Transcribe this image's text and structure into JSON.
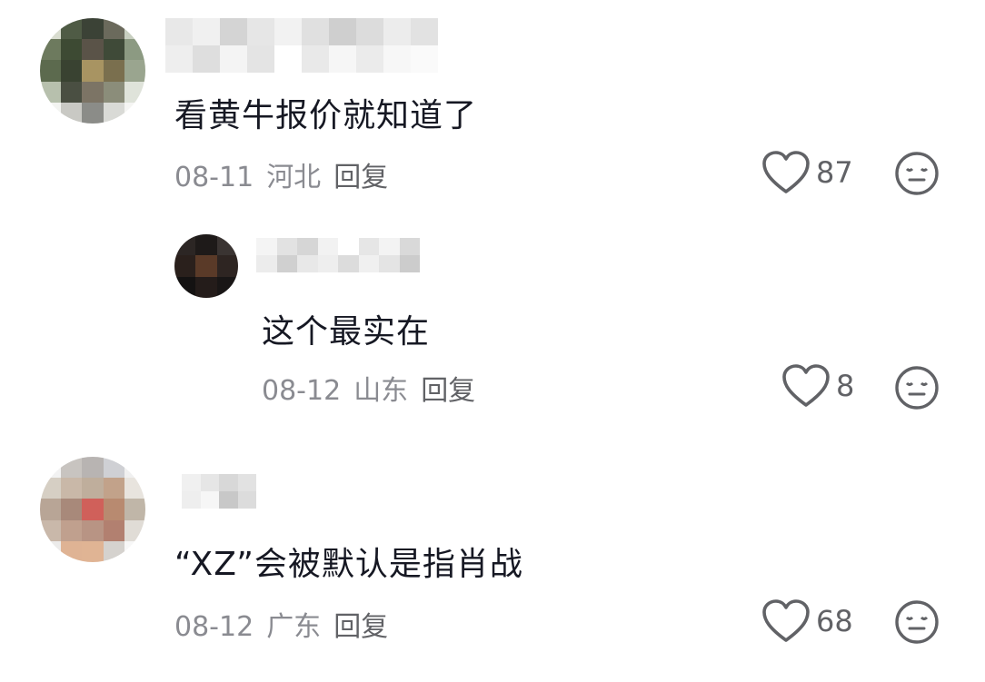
{
  "comments": [
    {
      "text": "看黄牛报价就知道了",
      "date": "08-11",
      "location": "河北",
      "reply_label": "回复",
      "likes": "87",
      "replies": [
        {
          "text": "这个最实在",
          "date": "08-12",
          "location": "山东",
          "reply_label": "回复",
          "likes": "8"
        }
      ]
    },
    {
      "text": "“XZ”会被默认是指肖战",
      "date": "08-12",
      "location": "广东",
      "reply_label": "回复",
      "likes": "68"
    }
  ],
  "icons": {
    "like": "heart-outline-icon",
    "dislike": "meh-face-icon"
  },
  "colors": {
    "text": "#161823",
    "meta": "#8a8b91",
    "icon": "#616266"
  }
}
